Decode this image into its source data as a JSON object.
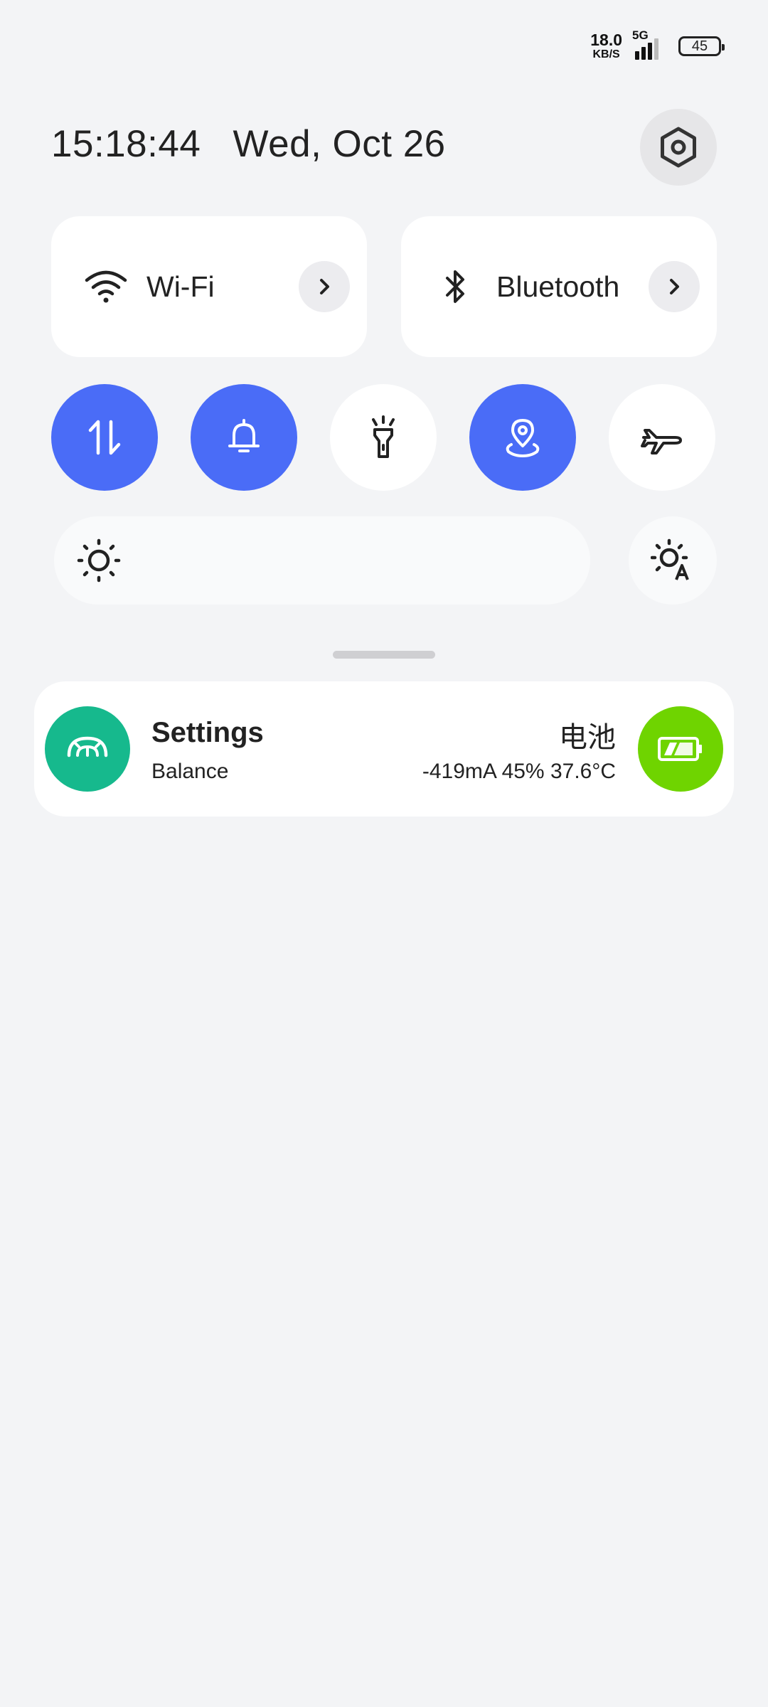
{
  "status_bar": {
    "net_speed_value": "18.0",
    "net_speed_unit": "KB/S",
    "network_type": "5G",
    "battery_level": "45"
  },
  "header": {
    "time": "15:18:44",
    "date": "Wed, Oct 26"
  },
  "tiles": {
    "wifi_label": "Wi-Fi",
    "bluetooth_label": "Bluetooth"
  },
  "toggles": [
    {
      "name": "mobile-data",
      "icon": "data-transfer-icon",
      "active": true
    },
    {
      "name": "sound",
      "icon": "bell-icon",
      "active": true
    },
    {
      "name": "flashlight",
      "icon": "flashlight-icon",
      "active": false
    },
    {
      "name": "location",
      "icon": "location-pin-icon",
      "active": true
    },
    {
      "name": "airplane-mode",
      "icon": "airplane-icon",
      "active": false
    }
  ],
  "colors": {
    "accent": "#4a6cf7",
    "settings_app": "#16b98d",
    "battery_app": "#6fd400"
  },
  "notification": {
    "app_title": "Settings",
    "app_subtitle": "Balance",
    "right_title": "电池",
    "right_subtitle": "-419mA 45% 37.6°C"
  }
}
